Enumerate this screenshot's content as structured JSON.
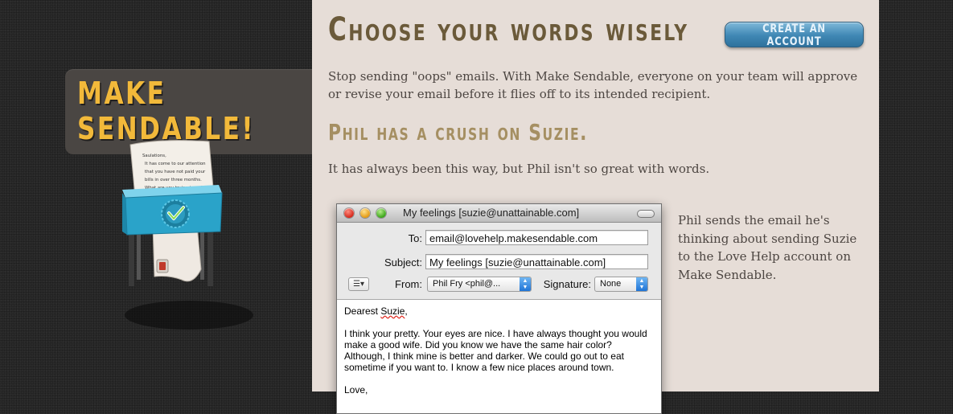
{
  "brand": {
    "line1": "Make",
    "line2": "Sendable!"
  },
  "illustration": {
    "paper_lines": [
      "Saulations,",
      "It has come to our attention",
      "that you have not paid your",
      "bills in over three months.",
      "What are you trying to pull?"
    ]
  },
  "header": {
    "headline": "Choose your words wisely",
    "create_account_label": "Create an Account"
  },
  "intro": "Stop sending \"oops\" emails. With Make Sendable, everyone on your team will approve or revise your email before it flies off to its intended recipient.",
  "section": {
    "title": "Phil has a crush on Suzie.",
    "text": "It has always been this way, but Phil isn't so great with words."
  },
  "mail": {
    "window_title": "My feelings [suzie@unattainable.com]",
    "to_label": "To:",
    "to_value": "email@lovehelp.makesendable.com",
    "subject_label": "Subject:",
    "subject_value": "My feelings [suzie@unattainable.com]",
    "from_label": "From:",
    "from_value": "Phil Fry <phil@...",
    "signature_label": "Signature:",
    "signature_value": "None",
    "greeting_prefix": "Dearest ",
    "greeting_name": "Suzie",
    "greeting_suffix": ",",
    "paragraph": "I think your pretty. Your eyes are nice. I have always thought you would make a good wife. Did you know we have the same hair color? Although, I think mine is better and darker. We could go out to eat sometime if you want to. I know a few nice places around town.",
    "closing": "Love,"
  },
  "side_note": "Phil sends the email he's thinking about sending Suzie to the Love Help account on Make Sendable.",
  "colors": {
    "panel_bg": "#e6ddd7",
    "headline": "#6b5a3a",
    "subheading": "#a58f62",
    "brand": "#f2b93a",
    "button": "#3f87b4",
    "shredder": "#2aa3c9"
  }
}
